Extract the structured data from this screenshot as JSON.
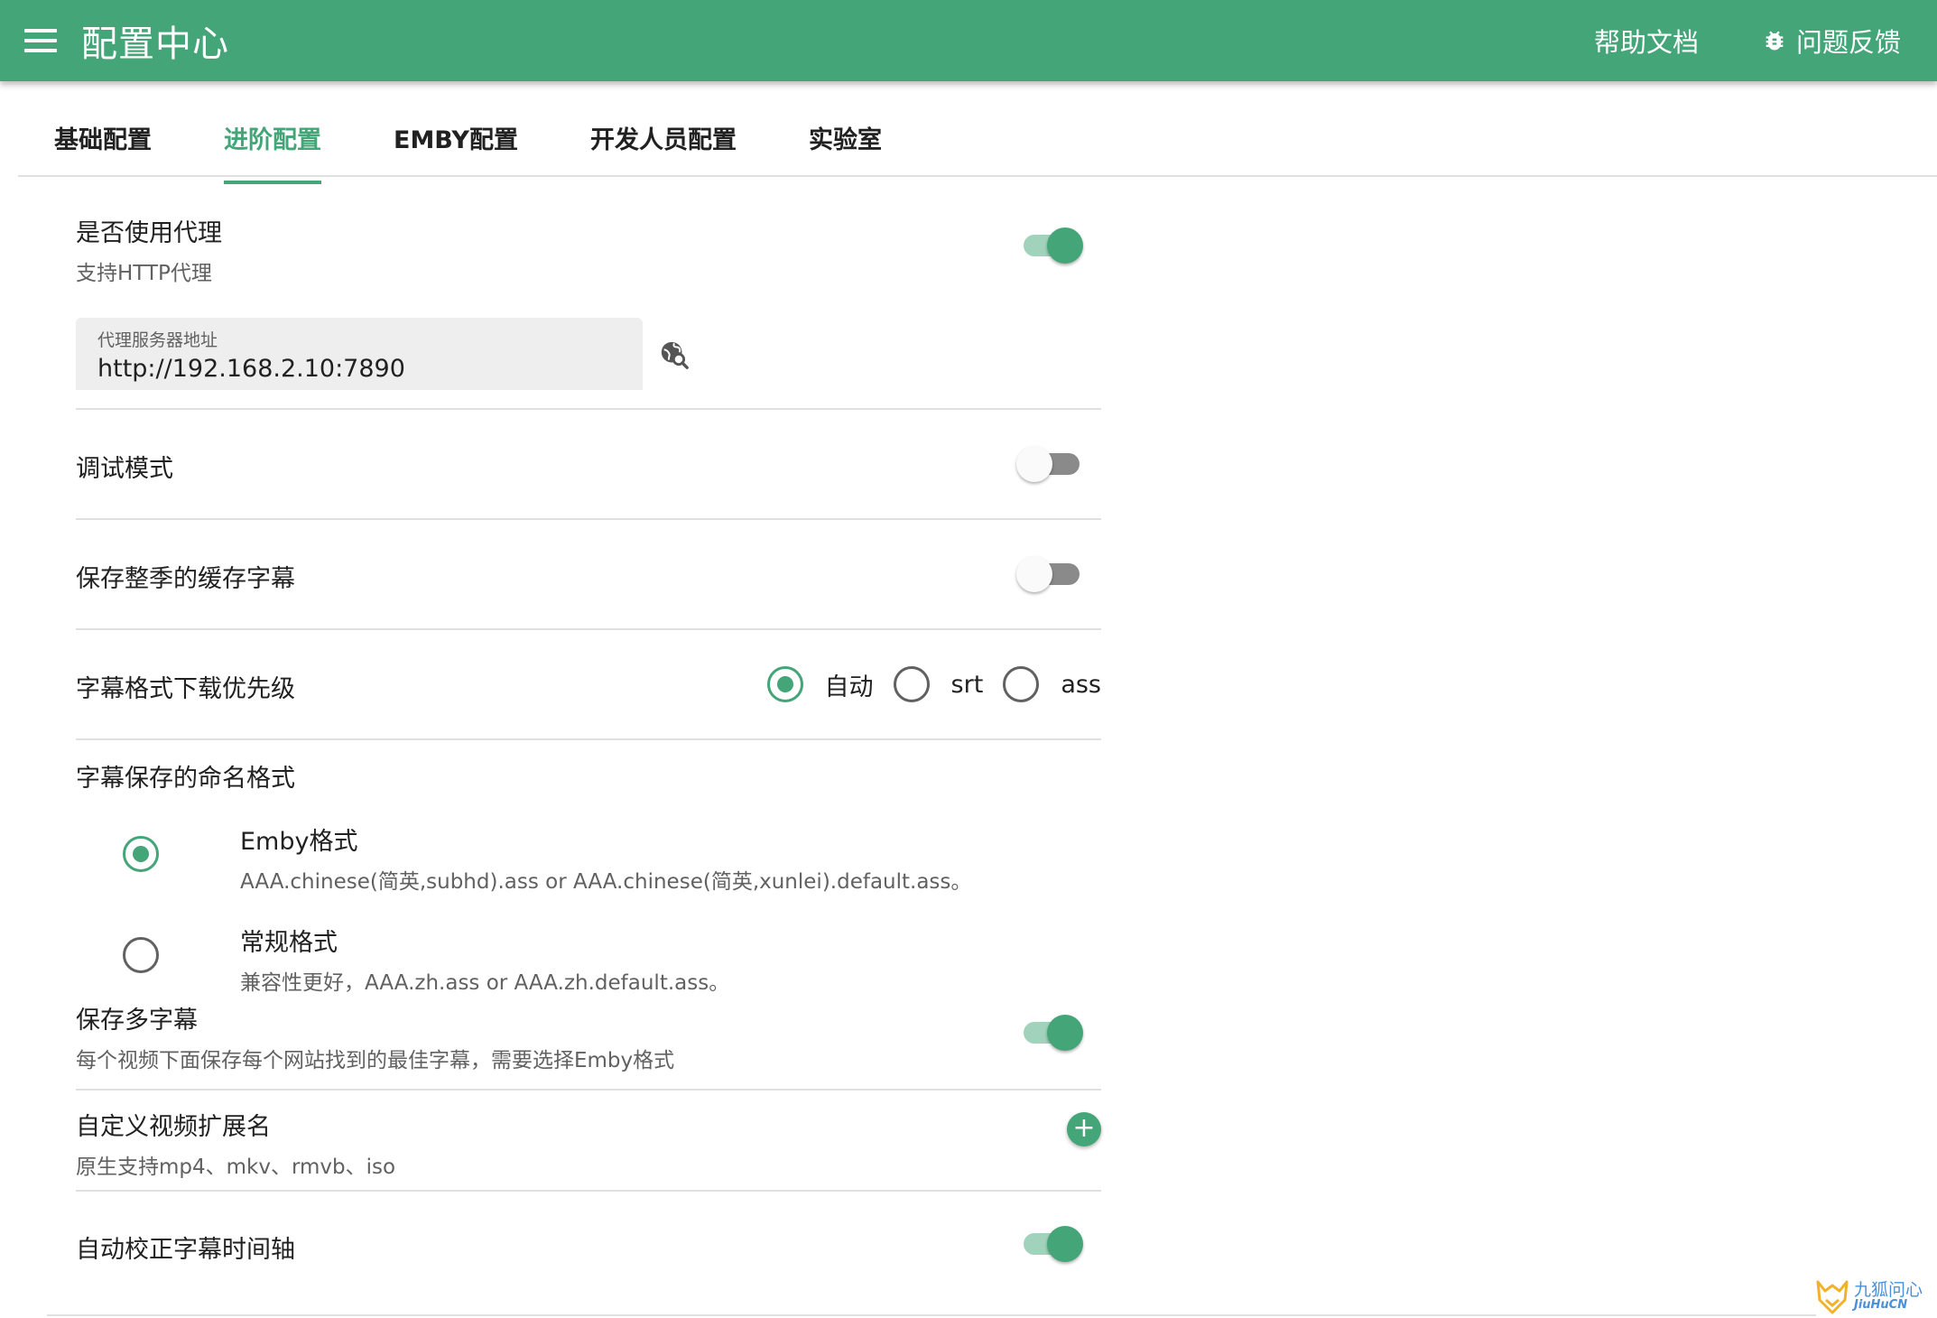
{
  "header": {
    "title": "配置中心",
    "menu_icon": "menu-icon",
    "links": [
      {
        "label": "帮助文档"
      },
      {
        "label": "问题反馈",
        "icon": "bug-icon"
      }
    ],
    "bg_color": "#43a578"
  },
  "tabs": [
    {
      "label": "基础配置",
      "active": false
    },
    {
      "label": "进阶配置",
      "active": true
    },
    {
      "label": "EMBY配置",
      "active": false
    },
    {
      "label": "开发人员配置",
      "active": false
    },
    {
      "label": "实验室",
      "active": false
    }
  ],
  "proxy": {
    "title": "是否使用代理",
    "subtitle": "支持HTTP代理",
    "enabled": true,
    "field_label": "代理服务器地址",
    "field_value": "http://192.168.2.10:7890",
    "test_icon": "search-globe-icon"
  },
  "debug": {
    "title": "调试模式",
    "enabled": false
  },
  "season_cache": {
    "title": "保存整季的缓存字幕",
    "enabled": false
  },
  "format_priority": {
    "title": "字幕格式下载优先级",
    "options": [
      {
        "label": "自动",
        "checked": true
      },
      {
        "label": "srt",
        "checked": false
      },
      {
        "label": "ass",
        "checked": false
      }
    ]
  },
  "naming": {
    "title": "字幕保存的命名格式",
    "options": [
      {
        "title": "Emby格式",
        "desc": "AAA.chinese(简英,subhd).ass or AAA.chinese(简英,xunlei).default.ass。",
        "checked": true
      },
      {
        "title": "常规格式",
        "desc": "兼容性更好，AAA.zh.ass or AAA.zh.default.ass。",
        "checked": false
      }
    ]
  },
  "multi_sub": {
    "title": "保存多字幕",
    "subtitle": "每个视频下面保存每个网站找到的最佳字幕，需要选择Emby格式",
    "enabled": true
  },
  "custom_ext": {
    "title": "自定义视频扩展名",
    "subtitle": "原生支持mp4、mkv、rmvb、iso",
    "add_icon": "plus-icon"
  },
  "auto_fix": {
    "title": "自动校正字幕时间轴",
    "enabled": true
  },
  "watermark": {
    "cn": "九狐问心",
    "en": "JiuHuCN"
  }
}
